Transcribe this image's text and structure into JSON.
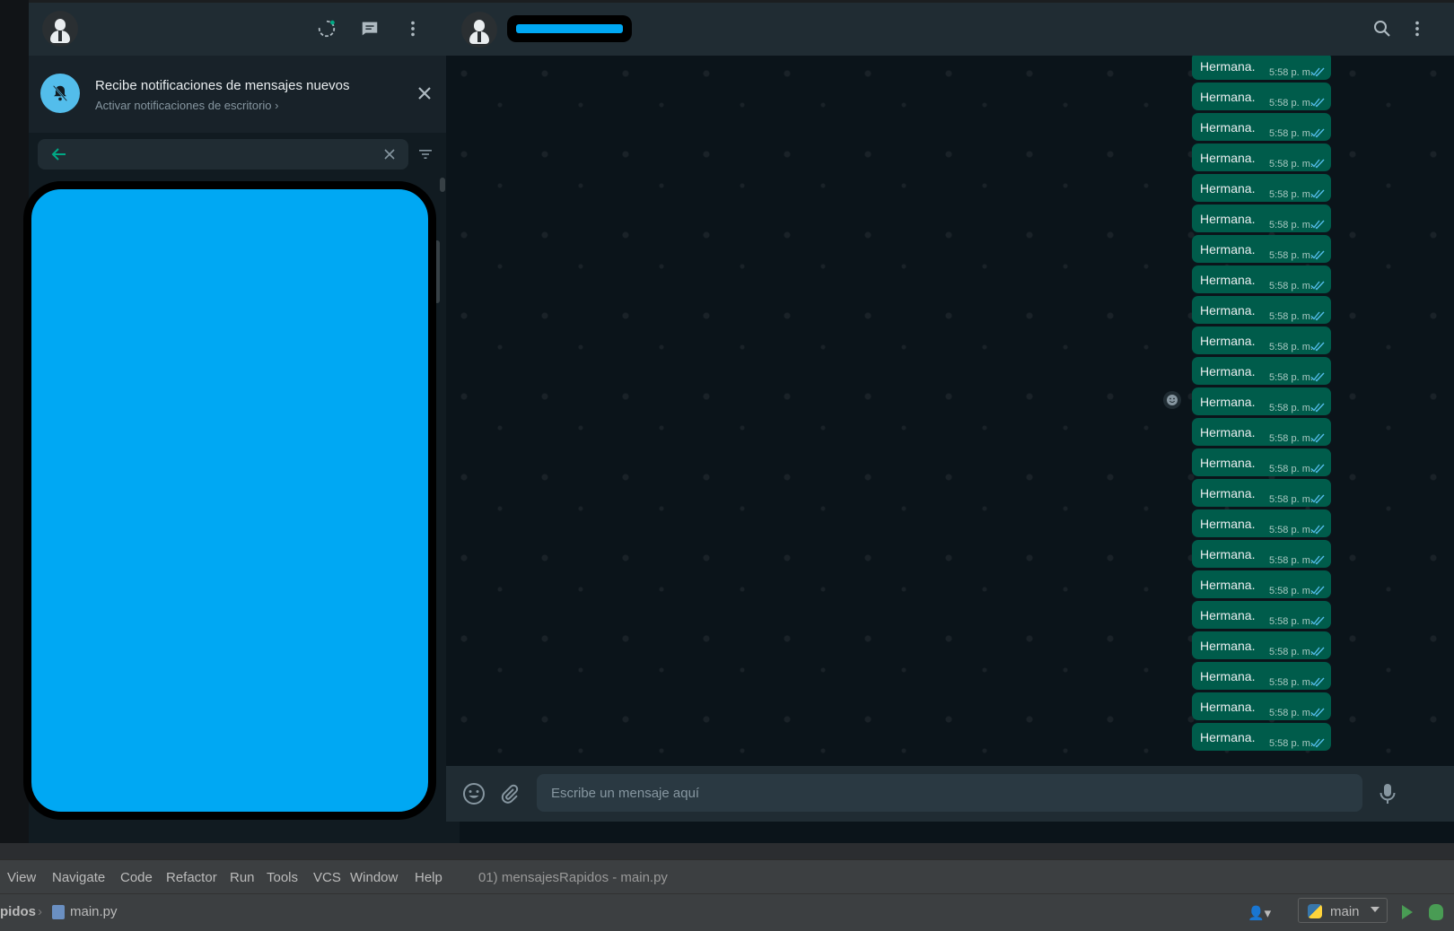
{
  "sidebar": {
    "notification": {
      "title": "Recibe notificaciones de mensajes nuevos",
      "subtitle": "Activar notificaciones de escritorio ›"
    },
    "search": {
      "value": ""
    }
  },
  "chat": {
    "messages": [
      {
        "text": "Hermana.",
        "time": "5:58 p. m."
      },
      {
        "text": "Hermana.",
        "time": "5:58 p. m."
      },
      {
        "text": "Hermana.",
        "time": "5:58 p. m."
      },
      {
        "text": "Hermana.",
        "time": "5:58 p. m."
      },
      {
        "text": "Hermana.",
        "time": "5:58 p. m."
      },
      {
        "text": "Hermana.",
        "time": "5:58 p. m."
      },
      {
        "text": "Hermana.",
        "time": "5:58 p. m."
      },
      {
        "text": "Hermana.",
        "time": "5:58 p. m."
      },
      {
        "text": "Hermana.",
        "time": "5:58 p. m."
      },
      {
        "text": "Hermana.",
        "time": "5:58 p. m."
      },
      {
        "text": "Hermana.",
        "time": "5:58 p. m."
      },
      {
        "text": "Hermana.",
        "time": "5:58 p. m."
      },
      {
        "text": "Hermana.",
        "time": "5:58 p. m."
      },
      {
        "text": "Hermana.",
        "time": "5:58 p. m."
      },
      {
        "text": "Hermana.",
        "time": "5:58 p. m."
      },
      {
        "text": "Hermana.",
        "time": "5:58 p. m."
      },
      {
        "text": "Hermana.",
        "time": "5:58 p. m."
      },
      {
        "text": "Hermana.",
        "time": "5:58 p. m."
      },
      {
        "text": "Hermana.",
        "time": "5:58 p. m."
      },
      {
        "text": "Hermana.",
        "time": "5:58 p. m."
      },
      {
        "text": "Hermana.",
        "time": "5:58 p. m."
      },
      {
        "text": "Hermana.",
        "time": "5:58 p. m."
      },
      {
        "text": "Hermana.",
        "time": "5:58 p. m."
      }
    ],
    "composer": {
      "placeholder": "Escribe un mensaje aquí"
    }
  },
  "ide": {
    "menu": [
      "View",
      "Navigate",
      "Code",
      "Refactor",
      "Run",
      "Tools",
      "VCS",
      "Window",
      "Help"
    ],
    "title": "01) mensajesRapidos - main.py",
    "breadcrumb": {
      "project": "pidos",
      "file": "main.py"
    },
    "run_config": "main"
  },
  "colors": {
    "accent": "#00a884",
    "outgoing_bubble": "#005c4b",
    "read_check": "#53bdeb",
    "redaction": "#00a8f3"
  }
}
